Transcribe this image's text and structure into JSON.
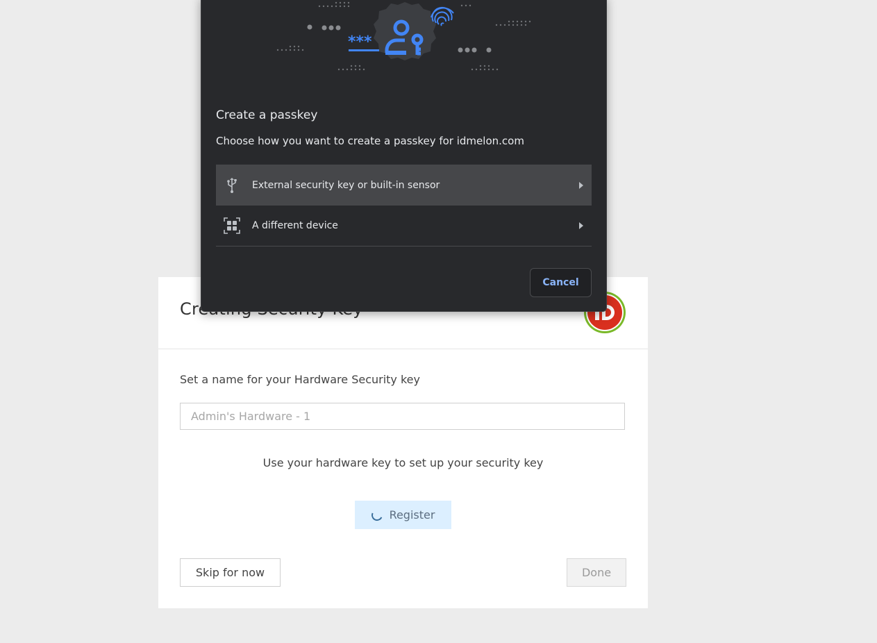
{
  "page": {
    "card": {
      "title": "Creating Security Key",
      "field_label": "Set a name for your Hardware Security key",
      "name_input": {
        "value": "",
        "placeholder": "Admin's Hardware - 1"
      },
      "hint": "Use your hardware key to set up your security key",
      "register_label": "Register",
      "skip_label": "Skip for now",
      "done_label": "Done"
    }
  },
  "dialog": {
    "title": "Create a passkey",
    "subtitle": "Choose how you want to create a passkey for idmelon.com",
    "options": [
      {
        "label": "External security key or built-in sensor",
        "icon": "usb-icon",
        "selected": true
      },
      {
        "label": "A different device",
        "icon": "qr-code-icon",
        "selected": false
      }
    ],
    "cancel_label": "Cancel"
  },
  "colors": {
    "dialog_bg": "#28292c",
    "accent_blue": "#8ab4f8",
    "illustration_blue": "#4285f4",
    "register_bg": "#dcefff",
    "logo_red": "#d9301f",
    "logo_green": "#7ab929"
  }
}
